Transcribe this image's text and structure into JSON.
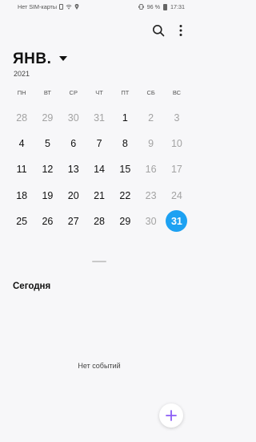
{
  "status": {
    "carrier": "Нет SIM-карты",
    "battery": "96 %",
    "time": "17:31"
  },
  "toolbar": {
    "search_icon": "search-icon",
    "more_icon": "more-vert-icon"
  },
  "calendar": {
    "month": "ЯНВ.",
    "year": "2021",
    "weekdays": [
      "ПН",
      "ВТ",
      "СР",
      "ЧТ",
      "ПТ",
      "СБ",
      "ВС"
    ],
    "days": [
      {
        "n": "28",
        "dim": true
      },
      {
        "n": "29",
        "dim": true
      },
      {
        "n": "30",
        "dim": true
      },
      {
        "n": "31",
        "dim": true
      },
      {
        "n": "1"
      },
      {
        "n": "2",
        "dim": true
      },
      {
        "n": "3",
        "dim": true
      },
      {
        "n": "4"
      },
      {
        "n": "5"
      },
      {
        "n": "6"
      },
      {
        "n": "7"
      },
      {
        "n": "8"
      },
      {
        "n": "9",
        "dim": true
      },
      {
        "n": "10",
        "dim": true
      },
      {
        "n": "11"
      },
      {
        "n": "12"
      },
      {
        "n": "13"
      },
      {
        "n": "14"
      },
      {
        "n": "15"
      },
      {
        "n": "16",
        "dim": true
      },
      {
        "n": "17",
        "dim": true
      },
      {
        "n": "18"
      },
      {
        "n": "19"
      },
      {
        "n": "20"
      },
      {
        "n": "21"
      },
      {
        "n": "22"
      },
      {
        "n": "23",
        "dim": true
      },
      {
        "n": "24",
        "dim": true
      },
      {
        "n": "25"
      },
      {
        "n": "26"
      },
      {
        "n": "27"
      },
      {
        "n": "28"
      },
      {
        "n": "29"
      },
      {
        "n": "30",
        "dim": true
      },
      {
        "n": "31",
        "today": true
      }
    ],
    "accent_color": "#1da1f2",
    "weekend_color": "#a3a3a3"
  },
  "events": {
    "section_title": "Сегодня",
    "empty_text": "Нет событий"
  },
  "fab": {
    "icon": "plus-icon",
    "color": "#8b5cf6"
  }
}
